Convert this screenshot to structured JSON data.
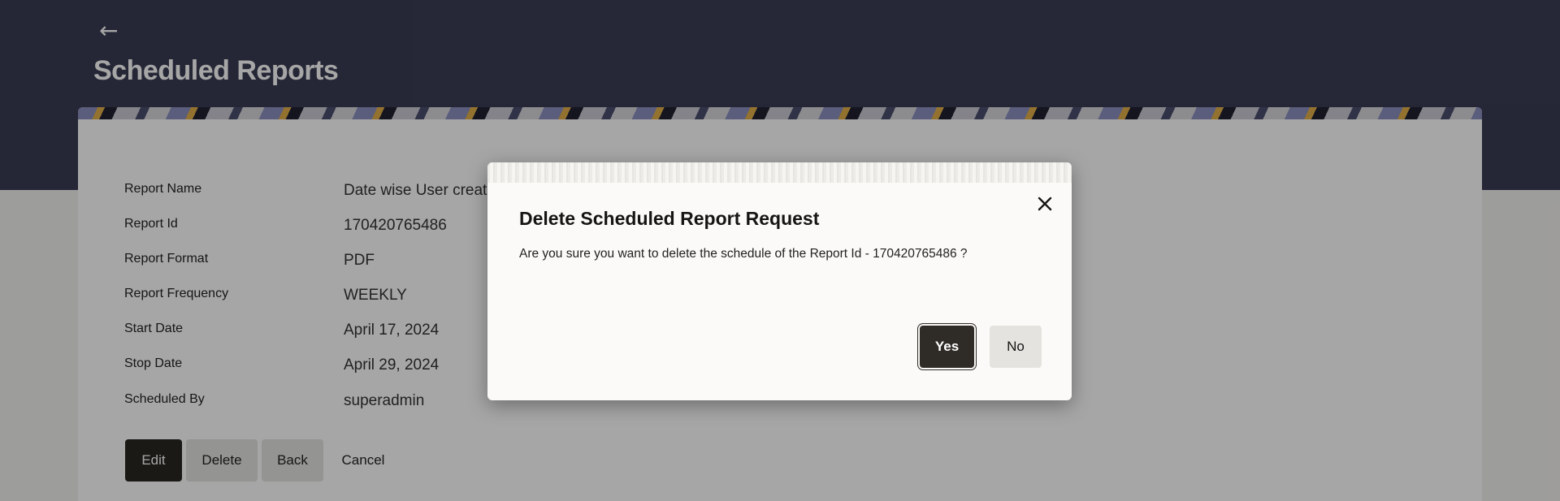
{
  "header": {
    "back_icon": "left-arrow-icon",
    "title": "Scheduled Reports"
  },
  "details": [
    {
      "label": "Report Name",
      "value": "Date wise User creati"
    },
    {
      "label": "Report Id",
      "value": "170420765486"
    },
    {
      "label": "Report Format",
      "value": "PDF"
    },
    {
      "label": "Report Frequency",
      "value": "WEEKLY"
    },
    {
      "label": "Start Date",
      "value": "April 17, 2024"
    },
    {
      "label": "Stop Date",
      "value": "April 29, 2024"
    },
    {
      "label": "Scheduled By",
      "value": "superadmin"
    }
  ],
  "actions": {
    "edit": "Edit",
    "delete": "Delete",
    "back": "Back",
    "cancel": "Cancel"
  },
  "modal": {
    "title": "Delete Scheduled Report Request",
    "message": "Are you sure you want to delete the schedule of the Report Id - 170420765486 ?",
    "yes": "Yes",
    "no": "No",
    "close_icon": "close-icon"
  },
  "colors": {
    "header_bg": "#3a3d55",
    "primary_button": "#2a2723",
    "secondary_button": "#e4e3e0"
  }
}
